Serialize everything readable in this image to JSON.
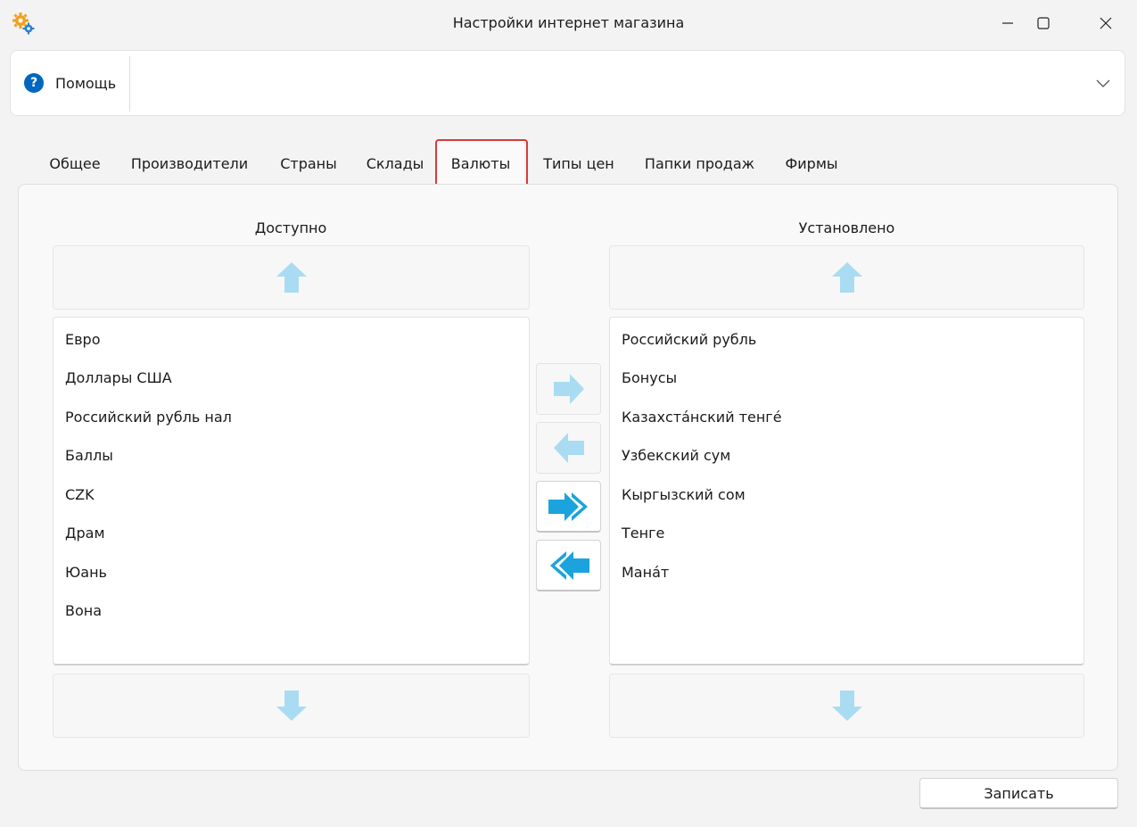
{
  "window": {
    "title": "Настройки интернет магазина",
    "icons": [
      "settings-gears-icon",
      "minimize-icon",
      "maximize-icon",
      "close-icon"
    ]
  },
  "help": {
    "label": "Помощь",
    "icon": "help-question-icon",
    "expand_icon": "chevron-down-icon"
  },
  "tabs": [
    {
      "label": "Общее"
    },
    {
      "label": "Производители"
    },
    {
      "label": "Страны"
    },
    {
      "label": "Склады"
    },
    {
      "label": "Валюты",
      "active": true
    },
    {
      "label": "Типы цен"
    },
    {
      "label": "Папки продаж"
    },
    {
      "label": "Фирмы"
    }
  ],
  "available": {
    "title": "Доступно",
    "items": [
      "Евро",
      "Доллары США",
      "Российский рубль нал",
      "Баллы",
      "CZK",
      "Драм",
      "Юань",
      "Вона"
    ]
  },
  "installed": {
    "title": "Установлено",
    "items": [
      "Российский рубль",
      "Бонусы",
      "Казахстáнский тенгé",
      "Узбекский сум",
      "Кыргызский сом",
      "Тенге",
      "Манáт"
    ]
  },
  "colors": {
    "accent": "#0067c0",
    "highlight": "#d93a3a",
    "arrow_light": "#a9dcf2",
    "arrow_strong": "#1aa3dd"
  },
  "save": {
    "label": "Записать"
  }
}
